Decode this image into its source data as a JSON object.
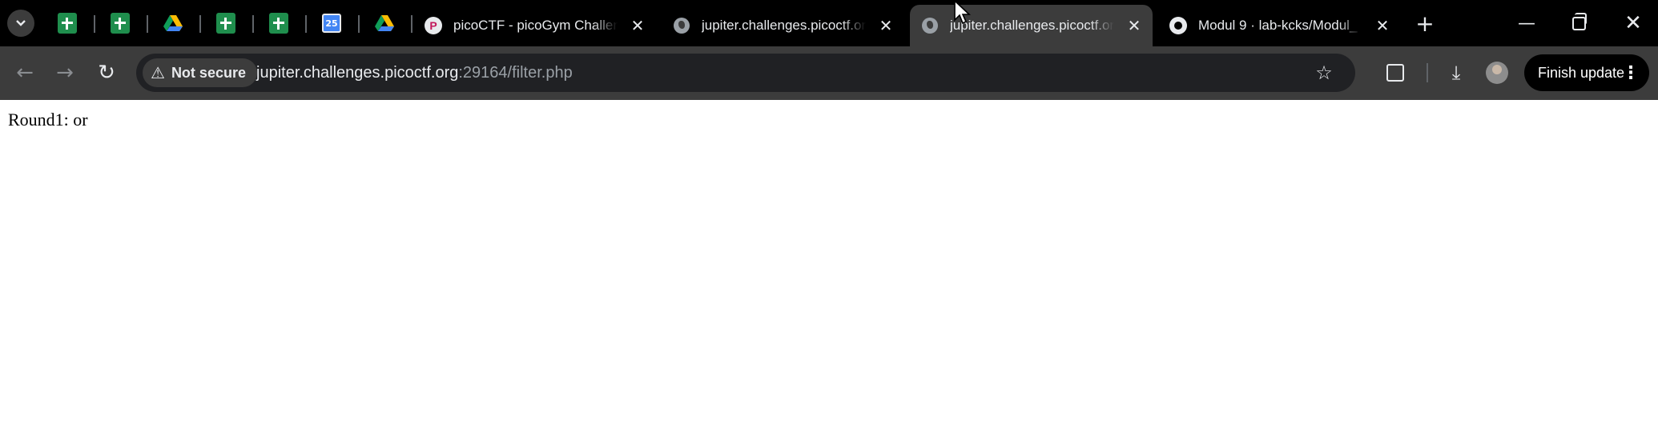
{
  "browser": {
    "pinned_tabs": [
      {
        "icon": "google-sheets-icon"
      },
      {
        "icon": "google-sheets-icon"
      },
      {
        "icon": "google-drive-icon"
      },
      {
        "icon": "google-sheets-icon"
      },
      {
        "icon": "google-sheets-icon"
      },
      {
        "icon": "google-calendar-icon",
        "label": "25"
      },
      {
        "icon": "google-drive-icon"
      }
    ],
    "tabs": [
      {
        "title": "picoCTF - picoGym Challen",
        "icon": "picoctf-icon",
        "active": false
      },
      {
        "title": "jupiter.challenges.picoctf.org",
        "icon": "globe-icon",
        "active": false
      },
      {
        "title": "jupiter.challenges.picoctf.org",
        "icon": "globe-icon",
        "active": true
      },
      {
        "title": "Modul 9 · lab-kcks/Modul_",
        "icon": "github-icon",
        "active": false
      }
    ],
    "toolbar": {
      "security_label": "Not secure",
      "url_host": "jupiter.challenges.picoctf.org",
      "url_rest": ":29164/filter.php",
      "finish_update_label": "Finish update"
    },
    "colors": {
      "tab_strip": "#000000",
      "toolbar": "#3c3c3c",
      "omnibox": "#202124"
    }
  },
  "page": {
    "text": "Round1: or"
  }
}
